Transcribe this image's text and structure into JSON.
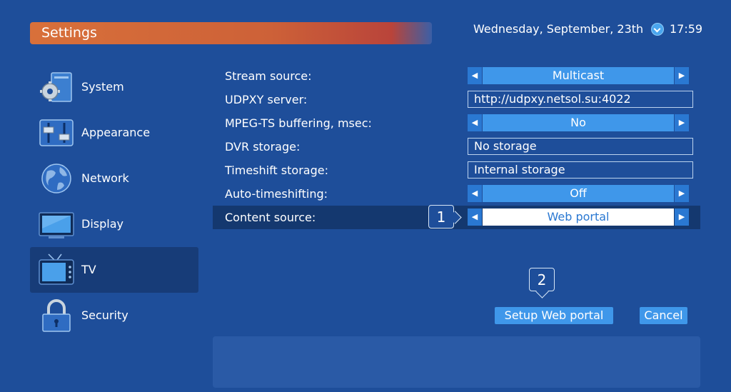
{
  "header": {
    "title": "Settings",
    "date": "Wednesday, September, 23th",
    "time": "17:59",
    "clock_icon": "clock-icon"
  },
  "sidebar": {
    "items": [
      {
        "label": "System",
        "icon": "system-gear-icon"
      },
      {
        "label": "Appearance",
        "icon": "sliders-icon"
      },
      {
        "label": "Network",
        "icon": "globe-icon"
      },
      {
        "label": "Display",
        "icon": "monitor-icon"
      },
      {
        "label": "TV",
        "icon": "tv-icon",
        "active": true
      },
      {
        "label": "Security",
        "icon": "padlock-icon"
      }
    ]
  },
  "settings": {
    "stream_source": {
      "label": "Stream source:",
      "value": "Multicast"
    },
    "udpxy_server": {
      "label": "UDPXY server:",
      "value": "http://udpxy.netsol.su:4022"
    },
    "mpeg_buffering": {
      "label": "MPEG-TS buffering, msec:",
      "value": "No"
    },
    "dvr_storage": {
      "label": "DVR storage:",
      "value": "No storage"
    },
    "timeshift_storage": {
      "label": "Timeshift storage:",
      "value": "Internal storage"
    },
    "auto_timeshifting": {
      "label": "Auto-timeshifting:",
      "value": "Off"
    },
    "content_source": {
      "label": "Content source:",
      "value": "Web portal"
    }
  },
  "arrows": {
    "left": "◀",
    "right": "▶"
  },
  "callouts": {
    "one": "1",
    "two": "2"
  },
  "buttons": {
    "setup_web_portal": "Setup Web portal",
    "cancel": "Cancel"
  },
  "colors": {
    "background": "#1e4e9a",
    "accent": "#3f97ea",
    "selected_row": "#14386f",
    "title_orange": "#d8703a"
  }
}
